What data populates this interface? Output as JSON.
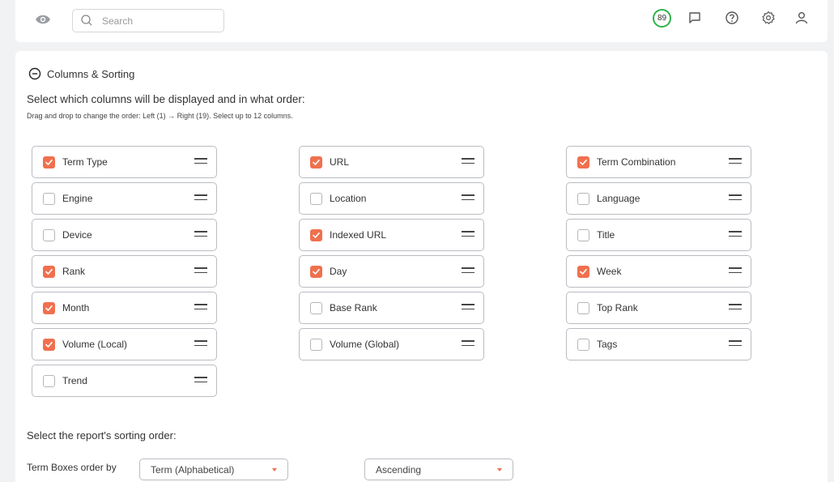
{
  "header": {
    "search_placeholder": "Search",
    "score": "89",
    "icons": [
      "eye-icon",
      "search-icon",
      "message-icon",
      "help-icon",
      "gear-icon",
      "user-icon"
    ]
  },
  "columns_section": {
    "title": "Columns & Sorting",
    "select_title": "Select which columns will be displayed and in what order:",
    "hint": "Drag and drop to change the order: Left (1) → Right (19). Select up to 12 columns.",
    "items": [
      {
        "label": "Term Type",
        "checked": true
      },
      {
        "label": "Engine",
        "checked": false
      },
      {
        "label": "Device",
        "checked": false
      },
      {
        "label": "Rank",
        "checked": true
      },
      {
        "label": "Month",
        "checked": true
      },
      {
        "label": "Volume (Local)",
        "checked": true
      },
      {
        "label": "Trend",
        "checked": false
      },
      {
        "label": "URL",
        "checked": true
      },
      {
        "label": "Location",
        "checked": false
      },
      {
        "label": "Indexed URL",
        "checked": true
      },
      {
        "label": "Day",
        "checked": true
      },
      {
        "label": "Base Rank",
        "checked": false
      },
      {
        "label": "Volume (Global)",
        "checked": false
      },
      {
        "label": "Term Combination",
        "checked": true
      },
      {
        "label": "Language",
        "checked": false
      },
      {
        "label": "Title",
        "checked": false
      },
      {
        "label": "Week",
        "checked": true
      },
      {
        "label": "Top Rank",
        "checked": false
      },
      {
        "label": "Tags",
        "checked": false
      }
    ]
  },
  "sorting": {
    "title": "Select the report's sorting order:",
    "label": "Term Boxes order by",
    "order_by": "Term (Alphabetical)",
    "direction": "Ascending"
  },
  "colors": {
    "accent": "#f0704e",
    "score_ring": "#2fb34a"
  }
}
